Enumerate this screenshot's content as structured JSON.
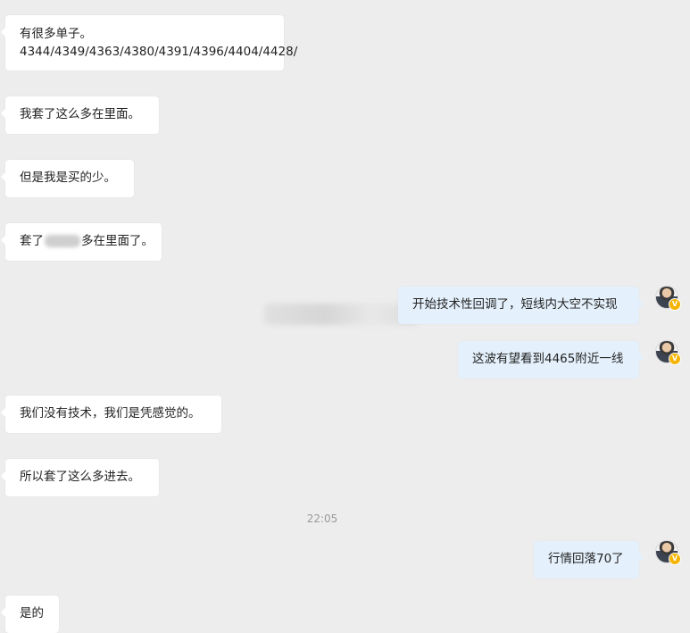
{
  "messages": {
    "m1_line1": "有很多单子。",
    "m1_line2": "4344/4349/4363/4380/4391/4396/4404/4428/",
    "m2": "我套了这么多在里面。",
    "m3": "但是我是买的少。",
    "m4_pre": "套了",
    "m4_post": "多在里面了。",
    "m5": "开始技术性回调了，短线内大空不实现",
    "m6": "这波有望看到4465附近一线",
    "m7": "我们没有技术，我们是凭感觉的。",
    "m8": "所以套了这么多进去。",
    "m9": "行情回落70了",
    "m10": "是的"
  },
  "timestamp": "22:05",
  "avatar_badge": "V",
  "colors": {
    "background": "#ededed",
    "incoming_bubble": "#ffffff",
    "outgoing_bubble": "#e4f0fb",
    "badge": "#f5b400"
  }
}
